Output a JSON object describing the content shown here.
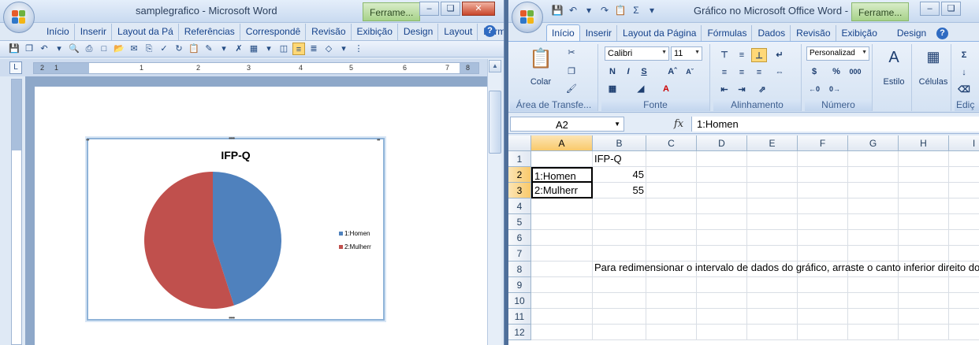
{
  "word": {
    "title": "samplegrafico - Microsoft Word",
    "context_tab": "Ferrame...",
    "tabs": [
      "Início",
      "Inserir",
      "Layout da Pá",
      "Referências",
      "Correspondê",
      "Revisão",
      "Exibição",
      "Design",
      "Layout",
      "Formatar"
    ],
    "ruler_numbers": [
      "1",
      "2",
      "1",
      "2",
      "3",
      "4",
      "5",
      "6",
      "7",
      "8"
    ]
  },
  "chart": {
    "title": "IFP-Q",
    "legend": [
      "1:Homen",
      "2:Mulherr"
    ]
  },
  "chart_data": {
    "type": "pie",
    "title": "IFP-Q",
    "categories": [
      "1:Homen",
      "2:Mulherr"
    ],
    "values": [
      45,
      55
    ],
    "colors": [
      "#4f81bd",
      "#c0504d"
    ],
    "legend_position": "right"
  },
  "excel": {
    "title": "Gráfico no Microsoft Office Word -",
    "context_tab": "Ferrame...",
    "tabs": [
      "Início",
      "Inserir",
      "Layout da Página",
      "Fórmulas",
      "Dados",
      "Revisão",
      "Exibição",
      "Design"
    ],
    "clipboard": {
      "paste_label": "Colar",
      "group_label": "Área de Transfe..."
    },
    "font": {
      "name": "Calibri",
      "size": "11",
      "group_label": "Fonte"
    },
    "alignment": {
      "group_label": "Alinhamento"
    },
    "number": {
      "format": "Personalizad",
      "group_label": "Número"
    },
    "styles": {
      "label": "Estilo"
    },
    "cells": {
      "label": "Células"
    },
    "editing": {
      "group_label": "Ediç"
    },
    "name_box": "A2",
    "fx_label": "fx",
    "formula": "1:Homen",
    "columns": [
      "A",
      "B",
      "C",
      "D",
      "E",
      "F",
      "G",
      "H",
      "I"
    ],
    "rows": [
      "1",
      "2",
      "3",
      "4",
      "5",
      "6",
      "7",
      "8",
      "9",
      "10",
      "11",
      "12"
    ],
    "cells_data": {
      "B1": "IFP-Q",
      "A2": "1:Homen",
      "B2": "45",
      "A3": "2:Mulherr",
      "B3": "55"
    },
    "note_row8": "Para redimensionar o intervalo de dados do gráfico, arraste o canto inferior direito do intervalo."
  },
  "colors": {
    "pie_blue": "#4f81bd",
    "pie_red": "#c0504d",
    "context_green": "#a7d28a",
    "selected_header": "#f9c96b"
  }
}
